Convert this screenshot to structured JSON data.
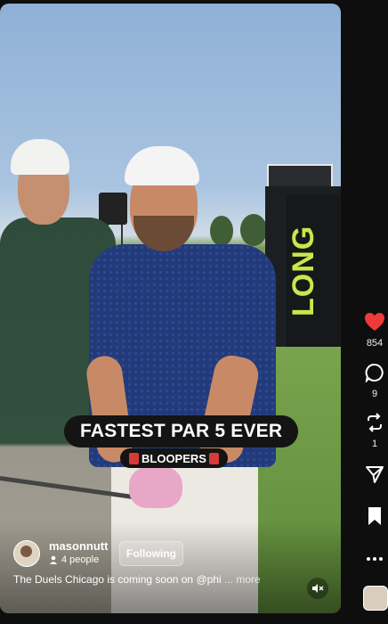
{
  "video": {
    "caption_main": "FASTEST PAR 5 EVER",
    "caption_sub": "BLOOPERS",
    "scene_sign_text": "LONG"
  },
  "creator": {
    "username": "masonnutt",
    "people_count": "4 people",
    "follow_label": "Following"
  },
  "description": {
    "text": "The Duels Chicago is coming soon on @phi",
    "more_label": "... more"
  },
  "actions": {
    "likes": "854",
    "comments": "9",
    "reposts": "1"
  },
  "colors": {
    "like": "#ee3a3a",
    "background": "#0e0e0f"
  },
  "icons": [
    "heart-icon",
    "comment-icon",
    "repost-icon",
    "share-icon",
    "bookmark-icon",
    "more-icon",
    "mute-icon",
    "person-icon"
  ]
}
